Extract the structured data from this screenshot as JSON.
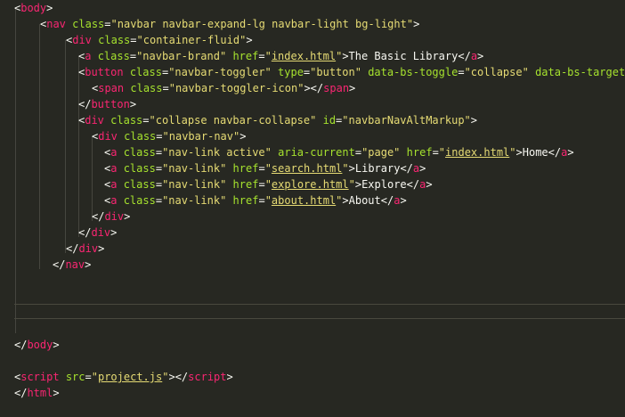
{
  "editor": {
    "theme": "dark",
    "colors": {
      "background": "#272822",
      "tag": "#f92672",
      "attribute": "#a6e22e",
      "string": "#e6db74",
      "text": "#f8f8f2"
    },
    "lines": [
      {
        "indent": 0,
        "tokens": [
          {
            "t": "p",
            "v": "<"
          },
          {
            "t": "tag",
            "v": "body"
          },
          {
            "t": "p",
            "v": ">"
          }
        ]
      },
      {
        "indent": 2,
        "tokens": [
          {
            "t": "p",
            "v": "<"
          },
          {
            "t": "tag",
            "v": "nav"
          },
          {
            "t": "p",
            "v": " "
          },
          {
            "t": "attr",
            "v": "class"
          },
          {
            "t": "p",
            "v": "="
          },
          {
            "t": "str",
            "v": "\"navbar navbar-expand-lg navbar-light bg-light\""
          },
          {
            "t": "p",
            "v": ">"
          }
        ]
      },
      {
        "indent": 4,
        "tokens": [
          {
            "t": "p",
            "v": "<"
          },
          {
            "t": "tag",
            "v": "div"
          },
          {
            "t": "p",
            "v": " "
          },
          {
            "t": "attr",
            "v": "class"
          },
          {
            "t": "p",
            "v": "="
          },
          {
            "t": "str",
            "v": "\"container-fluid\""
          },
          {
            "t": "p",
            "v": ">"
          }
        ]
      },
      {
        "indent": 5,
        "tokens": [
          {
            "t": "p",
            "v": "<"
          },
          {
            "t": "tag",
            "v": "a"
          },
          {
            "t": "p",
            "v": " "
          },
          {
            "t": "attr",
            "v": "class"
          },
          {
            "t": "p",
            "v": "="
          },
          {
            "t": "str",
            "v": "\"navbar-brand\""
          },
          {
            "t": "p",
            "v": " "
          },
          {
            "t": "attr",
            "v": "href"
          },
          {
            "t": "p",
            "v": "="
          },
          {
            "t": "str",
            "v": "\""
          },
          {
            "t": "link",
            "v": "index.html"
          },
          {
            "t": "str",
            "v": "\""
          },
          {
            "t": "p",
            "v": ">The Basic Library</"
          },
          {
            "t": "tag",
            "v": "a"
          },
          {
            "t": "p",
            "v": ">"
          }
        ]
      },
      {
        "indent": 5,
        "tokens": [
          {
            "t": "p",
            "v": "<"
          },
          {
            "t": "tag",
            "v": "button"
          },
          {
            "t": "p",
            "v": " "
          },
          {
            "t": "attr",
            "v": "class"
          },
          {
            "t": "p",
            "v": "="
          },
          {
            "t": "str",
            "v": "\"navbar-toggler\""
          },
          {
            "t": "p",
            "v": " "
          },
          {
            "t": "attr",
            "v": "type"
          },
          {
            "t": "p",
            "v": "="
          },
          {
            "t": "str",
            "v": "\"button\""
          },
          {
            "t": "p",
            "v": " "
          },
          {
            "t": "attr",
            "v": "data-bs-toggle"
          },
          {
            "t": "p",
            "v": "="
          },
          {
            "t": "str",
            "v": "\"collapse\""
          },
          {
            "t": "p",
            "v": " "
          },
          {
            "t": "attr",
            "v": "data-bs-target"
          }
        ]
      },
      {
        "indent": 6,
        "tokens": [
          {
            "t": "p",
            "v": "<"
          },
          {
            "t": "tag",
            "v": "span"
          },
          {
            "t": "p",
            "v": " "
          },
          {
            "t": "attr",
            "v": "class"
          },
          {
            "t": "p",
            "v": "="
          },
          {
            "t": "str",
            "v": "\"navbar-toggler-icon\""
          },
          {
            "t": "p",
            "v": "></"
          },
          {
            "t": "tag",
            "v": "span"
          },
          {
            "t": "p",
            "v": ">"
          }
        ]
      },
      {
        "indent": 5,
        "tokens": [
          {
            "t": "p",
            "v": "</"
          },
          {
            "t": "tag",
            "v": "button"
          },
          {
            "t": "p",
            "v": ">"
          }
        ]
      },
      {
        "indent": 5,
        "tokens": [
          {
            "t": "p",
            "v": "<"
          },
          {
            "t": "tag",
            "v": "div"
          },
          {
            "t": "p",
            "v": " "
          },
          {
            "t": "attr",
            "v": "class"
          },
          {
            "t": "p",
            "v": "="
          },
          {
            "t": "str",
            "v": "\"collapse navbar-collapse\""
          },
          {
            "t": "p",
            "v": " "
          },
          {
            "t": "attr",
            "v": "id"
          },
          {
            "t": "p",
            "v": "="
          },
          {
            "t": "str",
            "v": "\"navbarNavAltMarkup\""
          },
          {
            "t": "p",
            "v": ">"
          }
        ]
      },
      {
        "indent": 6,
        "tokens": [
          {
            "t": "p",
            "v": "<"
          },
          {
            "t": "tag",
            "v": "div"
          },
          {
            "t": "p",
            "v": " "
          },
          {
            "t": "attr",
            "v": "class"
          },
          {
            "t": "p",
            "v": "="
          },
          {
            "t": "str",
            "v": "\"navbar-nav\""
          },
          {
            "t": "p",
            "v": ">"
          }
        ]
      },
      {
        "indent": 7,
        "tokens": [
          {
            "t": "p",
            "v": "<"
          },
          {
            "t": "tag",
            "v": "a"
          },
          {
            "t": "p",
            "v": " "
          },
          {
            "t": "attr",
            "v": "class"
          },
          {
            "t": "p",
            "v": "="
          },
          {
            "t": "str",
            "v": "\"nav-link active\""
          },
          {
            "t": "p",
            "v": " "
          },
          {
            "t": "attr",
            "v": "aria-current"
          },
          {
            "t": "p",
            "v": "="
          },
          {
            "t": "str",
            "v": "\"page\""
          },
          {
            "t": "p",
            "v": " "
          },
          {
            "t": "attr",
            "v": "href"
          },
          {
            "t": "p",
            "v": "="
          },
          {
            "t": "str",
            "v": "\""
          },
          {
            "t": "link",
            "v": "index.html"
          },
          {
            "t": "str",
            "v": "\""
          },
          {
            "t": "p",
            "v": ">Home</"
          },
          {
            "t": "tag",
            "v": "a"
          },
          {
            "t": "p",
            "v": ">"
          }
        ]
      },
      {
        "indent": 7,
        "tokens": [
          {
            "t": "p",
            "v": "<"
          },
          {
            "t": "tag",
            "v": "a"
          },
          {
            "t": "p",
            "v": " "
          },
          {
            "t": "attr",
            "v": "class"
          },
          {
            "t": "p",
            "v": "="
          },
          {
            "t": "str",
            "v": "\"nav-link\""
          },
          {
            "t": "p",
            "v": " "
          },
          {
            "t": "attr",
            "v": "href"
          },
          {
            "t": "p",
            "v": "="
          },
          {
            "t": "str",
            "v": "\""
          },
          {
            "t": "link",
            "v": "search.html"
          },
          {
            "t": "str",
            "v": "\""
          },
          {
            "t": "p",
            "v": ">Library</"
          },
          {
            "t": "tag",
            "v": "a"
          },
          {
            "t": "p",
            "v": ">"
          }
        ]
      },
      {
        "indent": 7,
        "tokens": [
          {
            "t": "p",
            "v": "<"
          },
          {
            "t": "tag",
            "v": "a"
          },
          {
            "t": "p",
            "v": " "
          },
          {
            "t": "attr",
            "v": "class"
          },
          {
            "t": "p",
            "v": "="
          },
          {
            "t": "str",
            "v": "\"nav-link\""
          },
          {
            "t": "p",
            "v": " "
          },
          {
            "t": "attr",
            "v": "href"
          },
          {
            "t": "p",
            "v": "="
          },
          {
            "t": "str",
            "v": "\""
          },
          {
            "t": "link",
            "v": "explore.html"
          },
          {
            "t": "str",
            "v": "\""
          },
          {
            "t": "p",
            "v": ">Explore</"
          },
          {
            "t": "tag",
            "v": "a"
          },
          {
            "t": "p",
            "v": ">"
          }
        ]
      },
      {
        "indent": 7,
        "tokens": [
          {
            "t": "p",
            "v": "<"
          },
          {
            "t": "tag",
            "v": "a"
          },
          {
            "t": "p",
            "v": " "
          },
          {
            "t": "attr",
            "v": "class"
          },
          {
            "t": "p",
            "v": "="
          },
          {
            "t": "str",
            "v": "\"nav-link\""
          },
          {
            "t": "p",
            "v": " "
          },
          {
            "t": "attr",
            "v": "href"
          },
          {
            "t": "p",
            "v": "="
          },
          {
            "t": "str",
            "v": "\""
          },
          {
            "t": "link",
            "v": "about.html"
          },
          {
            "t": "str",
            "v": "\""
          },
          {
            "t": "p",
            "v": ">About</"
          },
          {
            "t": "tag",
            "v": "a"
          },
          {
            "t": "p",
            "v": ">"
          }
        ]
      },
      {
        "indent": 6,
        "tokens": [
          {
            "t": "p",
            "v": "</"
          },
          {
            "t": "tag",
            "v": "div"
          },
          {
            "t": "p",
            "v": ">"
          }
        ]
      },
      {
        "indent": 5,
        "tokens": [
          {
            "t": "p",
            "v": "</"
          },
          {
            "t": "tag",
            "v": "div"
          },
          {
            "t": "p",
            "v": ">"
          }
        ]
      },
      {
        "indent": 4,
        "tokens": [
          {
            "t": "p",
            "v": "</"
          },
          {
            "t": "tag",
            "v": "div"
          },
          {
            "t": "p",
            "v": ">"
          }
        ]
      },
      {
        "indent": 3,
        "tokens": [
          {
            "t": "p",
            "v": "</"
          },
          {
            "t": "tag",
            "v": "nav"
          },
          {
            "t": "p",
            "v": ">"
          }
        ]
      },
      {
        "indent": 0,
        "tokens": []
      },
      {
        "indent": 0,
        "tokens": []
      },
      {
        "indent": 0,
        "tokens": []
      },
      {
        "indent": 0,
        "tokens": []
      },
      {
        "indent": 0,
        "tokens": [
          {
            "t": "p",
            "v": "</"
          },
          {
            "t": "tag",
            "v": "body"
          },
          {
            "t": "p",
            "v": ">"
          }
        ]
      },
      {
        "indent": 0,
        "tokens": []
      },
      {
        "indent": 0,
        "tokens": [
          {
            "t": "p",
            "v": "<"
          },
          {
            "t": "tag",
            "v": "script"
          },
          {
            "t": "p",
            "v": " "
          },
          {
            "t": "attr",
            "v": "src"
          },
          {
            "t": "p",
            "v": "="
          },
          {
            "t": "str",
            "v": "\""
          },
          {
            "t": "link",
            "v": "project.js"
          },
          {
            "t": "str",
            "v": "\""
          },
          {
            "t": "p",
            "v": "></"
          },
          {
            "t": "tag",
            "v": "script"
          },
          {
            "t": "p",
            "v": ">"
          }
        ]
      },
      {
        "indent": 0,
        "tokens": [
          {
            "t": "p",
            "v": "</"
          },
          {
            "t": "tag",
            "v": "html"
          },
          {
            "t": "p",
            "v": ">"
          }
        ]
      }
    ]
  }
}
